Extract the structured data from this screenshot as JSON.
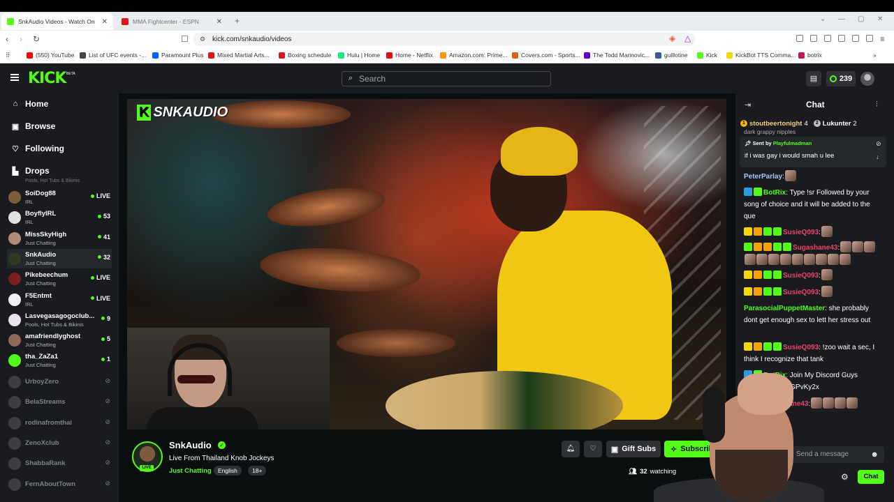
{
  "browser": {
    "tabs": [
      {
        "title": "SnkAudio Videos - Watch On",
        "color": "#53fc18",
        "active": true
      },
      {
        "title": "MMA Fightcenter - ESPN",
        "color": "#d71920",
        "active": false
      }
    ],
    "new_tab": "+",
    "url": "kick.com/snkaudio/videos",
    "bookmarks": [
      {
        "label": "(550) YouTube",
        "color": "#ff0000"
      },
      {
        "label": "List of UFC events -...",
        "color": "#444444"
      },
      {
        "label": "Paramount Plus",
        "color": "#0064ff"
      },
      {
        "label": "Mixed Martial Arts...",
        "color": "#d71920"
      },
      {
        "label": "Boxing schedule",
        "color": "#d71920"
      },
      {
        "label": "Hulu | Home",
        "color": "#1ce783"
      },
      {
        "label": "Home - Netflix",
        "color": "#e50914"
      },
      {
        "label": "Amazon.com: Prime...",
        "color": "#ff9900"
      },
      {
        "label": "Covers.com - Sports...",
        "color": "#e35c1d"
      },
      {
        "label": "The Todd Marinovic...",
        "color": "#6001d2"
      },
      {
        "label": "guillotine",
        "color": "#3b5998"
      },
      {
        "label": "Kick",
        "color": "#53fc18"
      },
      {
        "label": "KickBot TTS Comma...",
        "color": "#f5d800"
      },
      {
        "label": "botrix",
        "color": "#c2185b"
      }
    ]
  },
  "kick": {
    "logo": "KICK",
    "beta": "BETA",
    "search_placeholder": "Search",
    "points": "239"
  },
  "sidebar": {
    "nav": [
      {
        "label": "Home",
        "icon": "home-icon",
        "glyph": "⌂"
      },
      {
        "label": "Browse",
        "icon": "browse-icon",
        "glyph": "▣"
      },
      {
        "label": "Following",
        "icon": "heart-icon",
        "glyph": "♡"
      },
      {
        "label": "Drops",
        "icon": "drops-icon",
        "glyph": "▙"
      }
    ],
    "partial_text": "Pools, Hot Tubs & Bikinis",
    "channels": [
      {
        "name": "SoiDog88",
        "category": "IRL",
        "viewers": "LIVE",
        "color": "#7a5f3a"
      },
      {
        "name": "BoyflyIRL",
        "category": "IRL",
        "viewers": "53",
        "color": "#e1e1e1"
      },
      {
        "name": "MissSkyHigh",
        "category": "Just Chatting",
        "viewers": "41",
        "color": "#b08a7a"
      },
      {
        "name": "SnkAudio",
        "category": "Just Chatting",
        "viewers": "32",
        "color": "#2c3a24"
      },
      {
        "name": "Pikebeechum",
        "category": "Just Chatting",
        "viewers": "LIVE",
        "color": "#7a1d1d"
      },
      {
        "name": "F5Entmt",
        "category": "IRL",
        "viewers": "LIVE",
        "color": "#f1f1f1"
      },
      {
        "name": "Lasvegasagogoclub...",
        "category": "Pools, Hot Tubs & Bikinis",
        "viewers": "9",
        "color": "#e8e2f0"
      },
      {
        "name": "amafriendlyghost",
        "category": "Just Chatting",
        "viewers": "5",
        "color": "#8d6a5a"
      },
      {
        "name": "tha_ZaZa1",
        "category": "Just Chatting",
        "viewers": "1",
        "color": "#53fc18"
      }
    ],
    "offline": [
      "UrboyZero",
      "BelaStreams",
      "rodinafromthai",
      "ZenoXclub",
      "ShabbaRank",
      "FernAboutTown"
    ]
  },
  "video": {
    "watermark_k": "K",
    "watermark_text": "SNKAUDIO"
  },
  "channel": {
    "name": "SnkAudio",
    "live": "LIVE",
    "title": "Live From Thailand Knob Jockeys",
    "category": "Just Chatting",
    "tags": [
      "English",
      "18+"
    ],
    "gift_label": "Gift Subs",
    "subscribe_label": "Subscribe",
    "watching_count": "32",
    "watching_label": "watching"
  },
  "chat": {
    "title": "Chat",
    "gifters": [
      {
        "rank": "1",
        "name": "stoutbeertonight",
        "count": "4",
        "color": "#f5b800"
      },
      {
        "rank": "2",
        "name": "Lukunter",
        "count": "2",
        "color": "#c0c0c0"
      }
    ],
    "clipped": "dark grappy nipples",
    "pinned_by_label": "Sent by",
    "pinned_by_user": "Playfulmadman",
    "pinned_message": "if i was gay i would smah u lee",
    "messages": [
      {
        "user": "PeterParlay",
        "color": "#a8c7fa",
        "text": "",
        "badges": [],
        "emotes": 1
      },
      {
        "user": "BotRix",
        "color": "#53fc18",
        "text": "Type !sr Followed by your song of choice and it will be added to the que",
        "badges": [
          "#2d9cdb",
          "#53fc18"
        ],
        "emotes": 0
      },
      {
        "user": "SusieQ093",
        "color": "#f0436b",
        "text": "",
        "badges": [
          "#f5d800",
          "#f5a300",
          "#53fc18",
          "#53fc18"
        ],
        "emotes": 1
      },
      {
        "user": "Sugashane43",
        "color": "#f0436b",
        "text": "",
        "badges": [
          "#53fc18",
          "#f5a300",
          "#f5a300",
          "#53fc18",
          "#53fc18"
        ],
        "emotes": 12
      },
      {
        "user": "SusieQ093",
        "color": "#f0436b",
        "text": "",
        "badges": [
          "#f5d800",
          "#f5a300",
          "#53fc18",
          "#53fc18"
        ],
        "emotes": 1
      },
      {
        "user": "SusieQ093",
        "color": "#f0436b",
        "text": "",
        "badges": [
          "#f5d800",
          "#f5a300",
          "#53fc18",
          "#53fc18"
        ],
        "emotes": 1
      },
      {
        "user": "ParasocialPuppetMaster",
        "color": "#53fc18",
        "text": "she probably dont get enough sex to lett her stress out",
        "badges": [],
        "emotes": 0
      },
      {
        "user": "SusieQ093",
        "color": "#f0436b",
        "text": "!zoo wait a sec, I think I recognize that tank",
        "badges": [
          "#f5d800",
          "#f5a300",
          "#53fc18",
          "#53fc18"
        ],
        "emotes": 0
      },
      {
        "user": "BotRix",
        "color": "#53fc18",
        "text": "Join My Discord Guys discord.gg/FAcGPvKy2x",
        "badges": [
          "#2d9cdb",
          "#53fc18"
        ],
        "emotes": 0
      },
      {
        "user": "Sugashane43",
        "color": "#f0436b",
        "text": "",
        "badges": [
          "#53fc18",
          "#f5a300"
        ],
        "emotes": 4
      }
    ],
    "input_placeholder": "Send a message",
    "send_label": "Chat"
  }
}
